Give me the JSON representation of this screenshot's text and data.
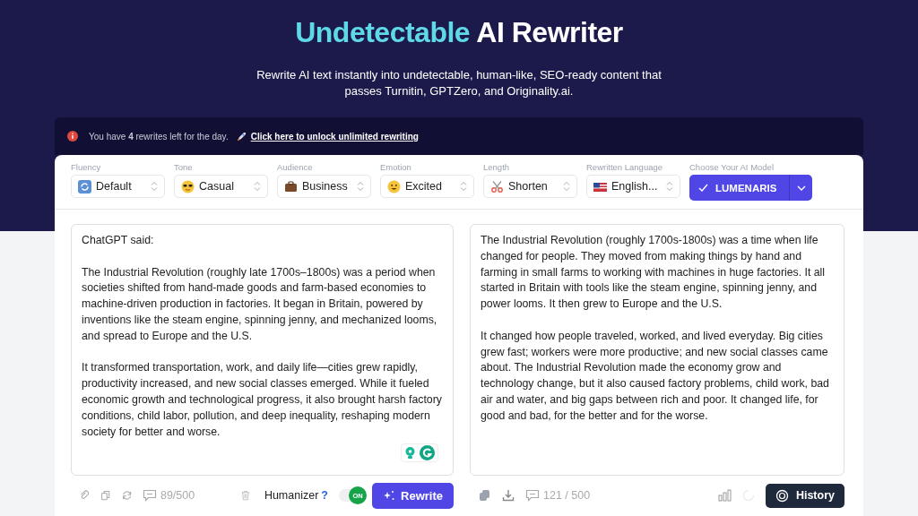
{
  "hero": {
    "title_accent": "Undetectable",
    "title_rest": "AI Rewriter",
    "subtitle": "Rewrite AI text instantly into undetectable, human-like, SEO-ready content that passes Turnitin, GPTZero, and Originality.ai."
  },
  "notice": {
    "text": "You have **4** rewrites left for the day.",
    "link": "Click here to unlock unlimited rewriting"
  },
  "settings": [
    {
      "label": "Fluency",
      "value": "Default"
    },
    {
      "label": "Tone",
      "value": "Casual"
    },
    {
      "label": "Audience",
      "value": "Business"
    },
    {
      "label": "Emotion",
      "value": "Excited"
    },
    {
      "label": "Length",
      "value": "Shorten"
    },
    {
      "label": "Rewritten Language",
      "value": "English..."
    }
  ],
  "model": {
    "label": "Choose Your AI Model",
    "value": "LUMENARIS"
  },
  "input": {
    "paragraphs": [
      "ChatGPT said:",
      "The Industrial Revolution (roughly late 1700s–1800s) was a period when societies shifted from hand-made goods and farm-based economies to machine-driven production in factories. It began in Britain, powered by inventions like the steam engine, spinning jenny, and mechanized looms, and spread to Europe and the U.S.",
      "It transformed transportation, work, and daily life—cities grew rapidly, productivity increased, and new social classes emerged. While it fueled economic growth and technological progress, it also brought harsh factory conditions, child labor, pollution, and deep inequality, reshaping modern society for better and worse."
    ],
    "count": "89/500"
  },
  "output": {
    "paragraphs": [
      "The Industrial Revolution (roughly 1700s-1800s) was a time when life changed for people. They moved from making things by hand and farming in small farms to working with machines in huge factories. It all started in Britain with tools like the steam engine, spinning jenny, and power looms. It then grew to Europe and the U.S.",
      "It changed how people traveled, worked, and lived everyday. Big cities grew fast; workers were more productive; and new social classes came about. The Industrial Revolution made the economy grow and technology change, but it also caused factory problems, child work, bad air and water, and big gaps between rich and poor. It changed life, for good and bad, for the better and for the worse."
    ],
    "count": "121 / 500"
  },
  "humanizer": {
    "label": "Humanizer",
    "help": "?",
    "toggle_text": "ON",
    "on": true
  },
  "rewrite_button": "Rewrite",
  "history_button": "History"
}
